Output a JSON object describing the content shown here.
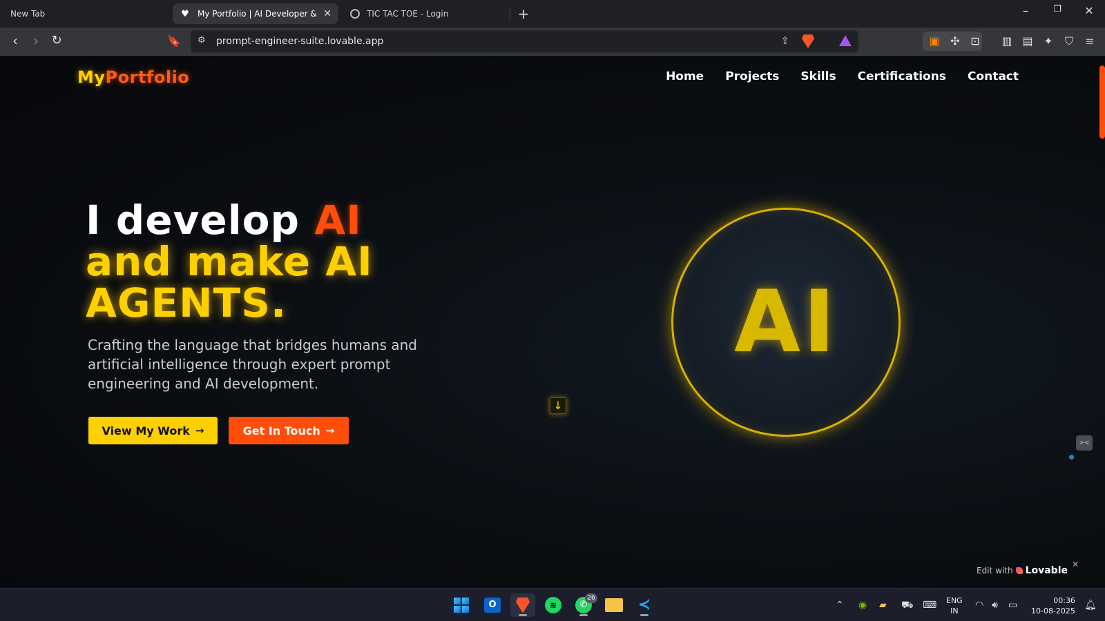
{
  "browser": {
    "tabs": [
      {
        "title": "New Tab"
      },
      {
        "title": "My Portfolio | AI Developer & Ag",
        "active": true
      },
      {
        "title": "TIC TAC TOE - Login"
      }
    ],
    "new_tab_symbol": "+",
    "window_controls": {
      "minimize": "–",
      "restore": "❐",
      "close": "✕"
    },
    "url": "prompt-engineer-suite.lovable.app"
  },
  "site": {
    "logo_part1": "My",
    "logo_part2": "Portfolio",
    "nav": [
      "Home",
      "Projects",
      "Skills",
      "Certifications",
      "Contact"
    ],
    "hero": {
      "line1_prefix": "I develop ",
      "line1_accent": "AI",
      "line2": "and make AI",
      "line3": "AGENTS.",
      "subtitle": "Crafting the language that bridges humans and artificial intelligence through expert prompt engineering and AI development."
    },
    "buttons": {
      "primary": "View My Work",
      "secondary": "Get In Touch",
      "arrow": "→"
    },
    "scroll_icon": "↓",
    "circle_text": "AI",
    "edit_with": "Edit with",
    "lovable": "Lovable",
    "colors": {
      "yellow": "#ffd000",
      "orange": "#ff4d0a"
    }
  },
  "taskbar": {
    "whatsapp_badge": "26",
    "lang_line1": "ENG",
    "lang_line2": "IN",
    "time": "00:36",
    "date": "10-08-2025"
  }
}
